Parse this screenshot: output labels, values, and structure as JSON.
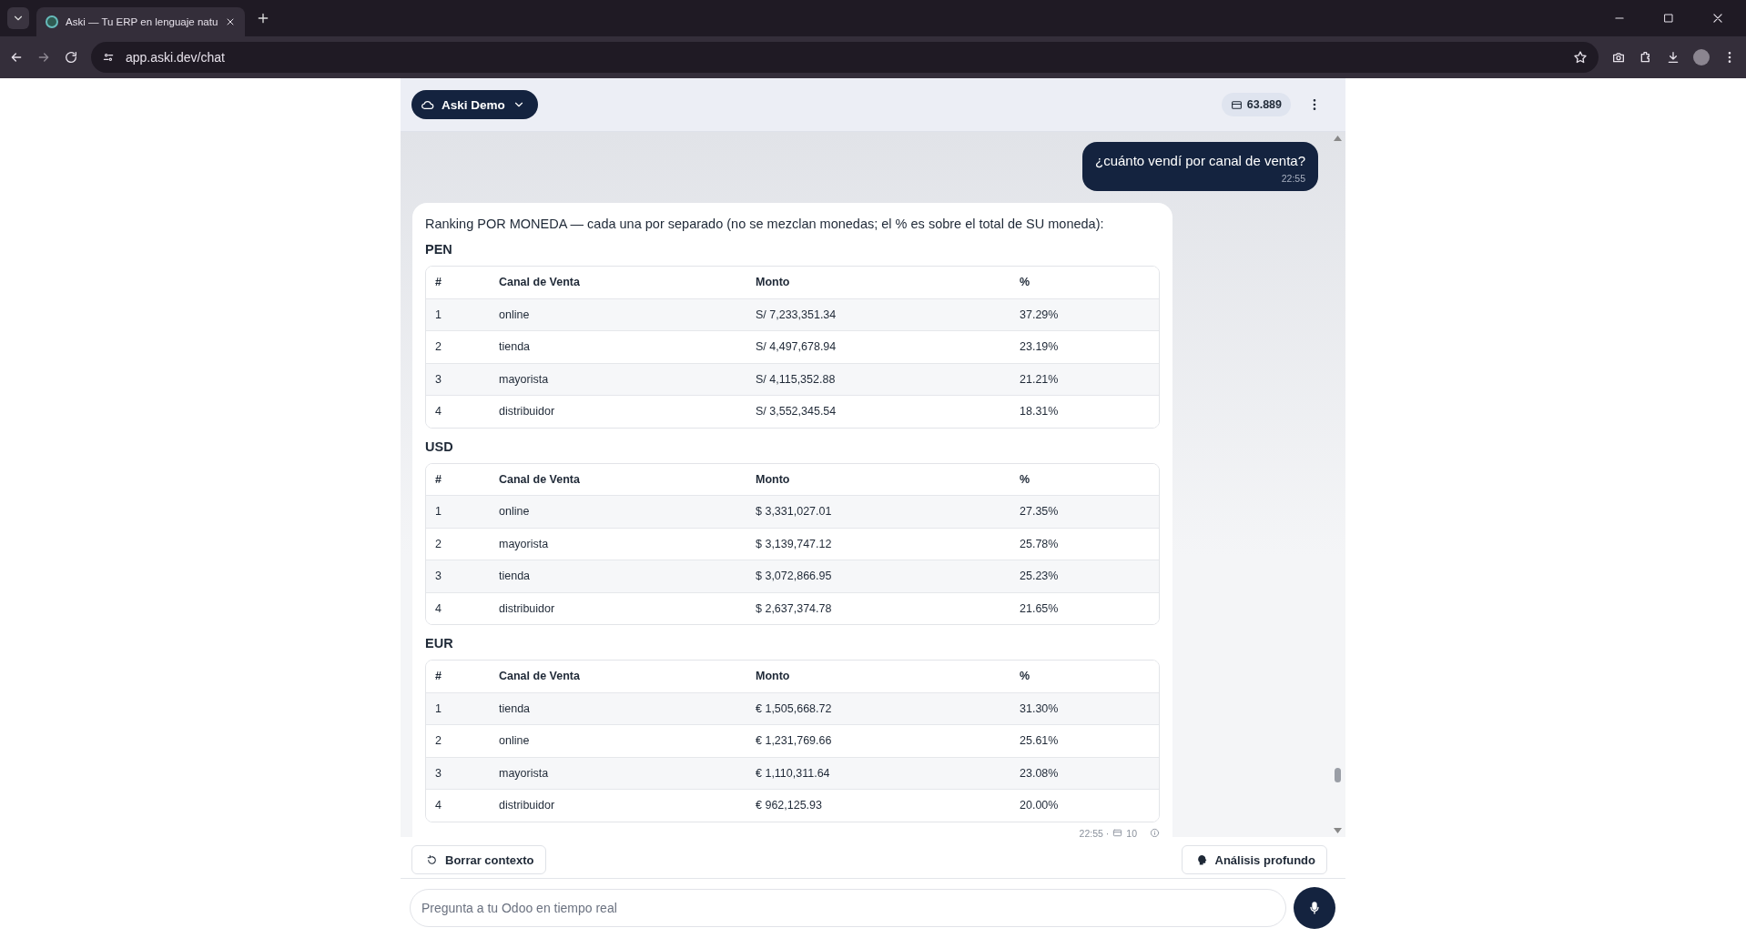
{
  "browser": {
    "tab_title": "Aski — Tu ERP en lenguaje natu",
    "url": "app.aski.dev/chat"
  },
  "header": {
    "workspace": "Aski Demo",
    "credits": "63.889"
  },
  "messages": [
    {
      "kind": "user",
      "text": "¿cuánto vendí por canal de venta?",
      "time": "22:55"
    },
    {
      "kind": "bot",
      "intro": "Ranking POR MONEDA — cada una por separado (no se mezclan monedas; el % es sobre el total de SU moneda):",
      "sections": [
        {
          "currency": "PEN",
          "columns": [
            "#",
            "Canal de Venta",
            "Monto",
            "%"
          ],
          "rows": [
            [
              "1",
              "online",
              "S/ 7,233,351.34",
              "37.29%"
            ],
            [
              "2",
              "tienda",
              "S/ 4,497,678.94",
              "23.19%"
            ],
            [
              "3",
              "mayorista",
              "S/ 4,115,352.88",
              "21.21%"
            ],
            [
              "4",
              "distribuidor",
              "S/ 3,552,345.54",
              "18.31%"
            ]
          ]
        },
        {
          "currency": "USD",
          "columns": [
            "#",
            "Canal de Venta",
            "Monto",
            "%"
          ],
          "rows": [
            [
              "1",
              "online",
              "$ 3,331,027.01",
              "27.35%"
            ],
            [
              "2",
              "mayorista",
              "$ 3,139,747.12",
              "25.78%"
            ],
            [
              "3",
              "tienda",
              "$ 3,072,866.95",
              "25.23%"
            ],
            [
              "4",
              "distribuidor",
              "$ 2,637,374.78",
              "21.65%"
            ]
          ]
        },
        {
          "currency": "EUR",
          "columns": [
            "#",
            "Canal de Venta",
            "Monto",
            "%"
          ],
          "rows": [
            [
              "1",
              "tienda",
              "€ 1,505,668.72",
              "31.30%"
            ],
            [
              "2",
              "online",
              "€ 1,231,769.66",
              "25.61%"
            ],
            [
              "3",
              "mayorista",
              "€ 1,110,311.64",
              "23.08%"
            ],
            [
              "4",
              "distribuidor",
              "€ 962,125.93",
              "20.00%"
            ]
          ]
        }
      ],
      "meta": {
        "time": "22:55 ·",
        "tokens": "10"
      }
    }
  ],
  "actions": [
    {
      "kind": "reset",
      "label": "Borrar contexto"
    },
    {
      "kind": "deep",
      "label": "Análisis profundo"
    }
  ],
  "composer": {
    "placeholder": "Pregunta a tu Odoo en tiempo real"
  }
}
